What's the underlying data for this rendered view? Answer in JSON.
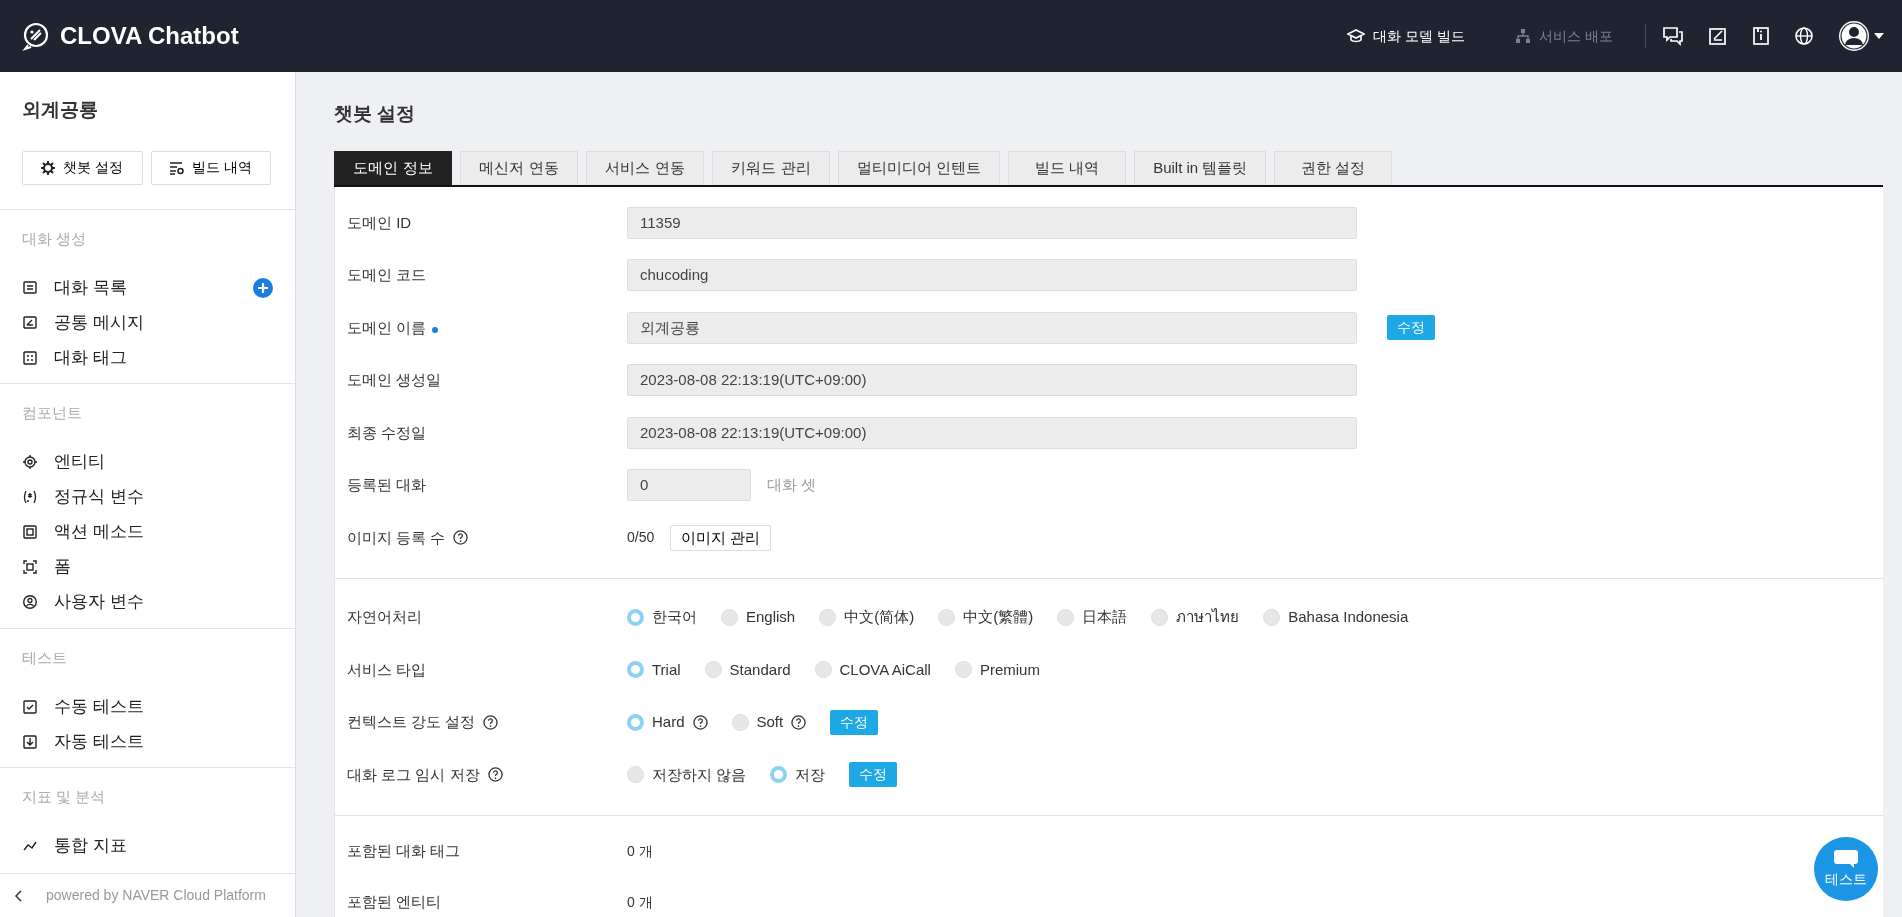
{
  "header": {
    "logo": "CLOVA Chatbot",
    "nav": [
      {
        "label": "대화 모델 빌드",
        "disabled": false
      },
      {
        "label": "서비스 배포",
        "disabled": true
      }
    ]
  },
  "sidebar": {
    "title": "외계공룡",
    "buttons": [
      "챗봇 설정",
      "빌드 내역"
    ],
    "sections": [
      {
        "title": "대화 생성",
        "items": [
          {
            "label": "대화 목록",
            "add": true
          },
          {
            "label": "공통 메시지",
            "add": false
          },
          {
            "label": "대화 태그",
            "add": false
          }
        ]
      },
      {
        "title": "컴포넌트",
        "items": [
          {
            "label": "엔티티",
            "add": false
          },
          {
            "label": "정규식 변수",
            "add": false
          },
          {
            "label": "액션 메소드",
            "add": false
          },
          {
            "label": "폼",
            "add": false
          },
          {
            "label": "사용자 변수",
            "add": false
          }
        ]
      },
      {
        "title": "테스트",
        "items": [
          {
            "label": "수동 테스트",
            "add": false
          },
          {
            "label": "자동 테스트",
            "add": false
          }
        ]
      },
      {
        "title": "지표 및 분석",
        "items": [
          {
            "label": "통합 지표",
            "add": false
          }
        ]
      }
    ],
    "footer": "powered by NAVER Cloud Platform"
  },
  "page_title": "챗봇 설정",
  "tabs": [
    {
      "label": "도메인 정보",
      "selected": true
    },
    {
      "label": "메신저 연동",
      "selected": false
    },
    {
      "label": "서비스 연동",
      "selected": false
    },
    {
      "label": "키워드 관리",
      "selected": false
    },
    {
      "label": "멀티미디어 인텐트",
      "selected": false
    },
    {
      "label": "빌드 내역",
      "selected": false
    },
    {
      "label": "Built in 템플릿",
      "selected": false
    },
    {
      "label": "권한 설정",
      "selected": false
    }
  ],
  "info_rows": [
    {
      "kind": "field",
      "label": "도메인 ID",
      "value": "11359"
    },
    {
      "kind": "field",
      "label": "도메인 코드",
      "value": "chucoding"
    },
    {
      "kind": "field",
      "label": "도메인 이름",
      "value": "외계공룡",
      "required": true,
      "edit_button": "수정"
    },
    {
      "kind": "field",
      "label": "도메인 생성일",
      "value": "2023-08-08 22:13:19(UTC+09:00)"
    },
    {
      "kind": "field",
      "label": "최종 수정일",
      "value": "2023-08-08 22:13:19(UTC+09:00)"
    },
    {
      "kind": "short",
      "label": "등록된 대화",
      "value": "0",
      "suffix": "대화 셋"
    },
    {
      "kind": "text",
      "label": "이미지 등록 수",
      "help": true,
      "value": "0/50",
      "button": "이미지 관리"
    }
  ],
  "settings": [
    {
      "label": "자연어처리",
      "help": false,
      "options": [
        {
          "label": "한국어",
          "selected": true
        },
        {
          "label": "English",
          "selected": false
        },
        {
          "label": "中文(简体)",
          "selected": false
        },
        {
          "label": "中文(繁體)",
          "selected": false
        },
        {
          "label": "日本語",
          "selected": false
        },
        {
          "label": "ภาษาไทย",
          "selected": false
        },
        {
          "label": "Bahasa Indonesia",
          "selected": false
        }
      ]
    },
    {
      "label": "서비스 타입",
      "help": false,
      "options": [
        {
          "label": "Trial",
          "selected": true
        },
        {
          "label": "Standard",
          "selected": false
        },
        {
          "label": "CLOVA AiCall",
          "selected": false
        },
        {
          "label": "Premium",
          "selected": false
        }
      ]
    },
    {
      "label": "컨텍스트 강도 설정",
      "help": true,
      "options": [
        {
          "label": "Hard",
          "selected": true,
          "help": true
        },
        {
          "label": "Soft",
          "selected": false,
          "help": true
        }
      ],
      "edit_button": "수정"
    },
    {
      "label": "대화 로그 임시 저장",
      "help": true,
      "options": [
        {
          "label": "저장하지 않음",
          "selected": false
        },
        {
          "label": "저장",
          "selected": true
        }
      ],
      "edit_button": "수정"
    }
  ],
  "summary": [
    {
      "label": "포함된 대화 태그",
      "value": "0 개"
    },
    {
      "label": "포함된 엔티티",
      "value": "0 개"
    }
  ],
  "test_button": "테스트"
}
